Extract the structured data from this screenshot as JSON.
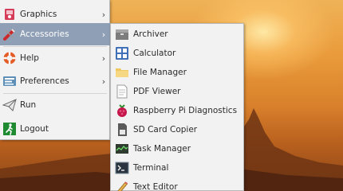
{
  "main_menu": {
    "items": [
      {
        "label": "Graphics",
        "icon": "graphics-icon",
        "has_submenu": true
      },
      {
        "label": "Accessories",
        "icon": "accessories-icon",
        "has_submenu": true,
        "active": true
      },
      {
        "label": "Help",
        "icon": "help-lifebuoy-icon",
        "has_submenu": true
      },
      {
        "label": "Preferences",
        "icon": "preferences-icon",
        "has_submenu": true
      },
      {
        "label": "Run",
        "icon": "run-paper-plane-icon",
        "has_submenu": false
      },
      {
        "label": "Logout",
        "icon": "logout-icon",
        "has_submenu": false
      }
    ],
    "submenu_arrow": "›",
    "active_color": "#8fa0b6"
  },
  "accessories_submenu": {
    "items": [
      {
        "label": "Archiver",
        "icon": "archiver-icon"
      },
      {
        "label": "Calculator",
        "icon": "calculator-icon"
      },
      {
        "label": "File Manager",
        "icon": "folder-icon"
      },
      {
        "label": "PDF Viewer",
        "icon": "pdf-viewer-icon"
      },
      {
        "label": "Raspberry Pi Diagnostics",
        "icon": "raspberry-icon"
      },
      {
        "label": "SD Card Copier",
        "icon": "sd-card-icon"
      },
      {
        "label": "Task Manager",
        "icon": "task-manager-icon"
      },
      {
        "label": "Terminal",
        "icon": "terminal-icon"
      },
      {
        "label": "Text Editor",
        "icon": "text-editor-icon"
      }
    ]
  }
}
